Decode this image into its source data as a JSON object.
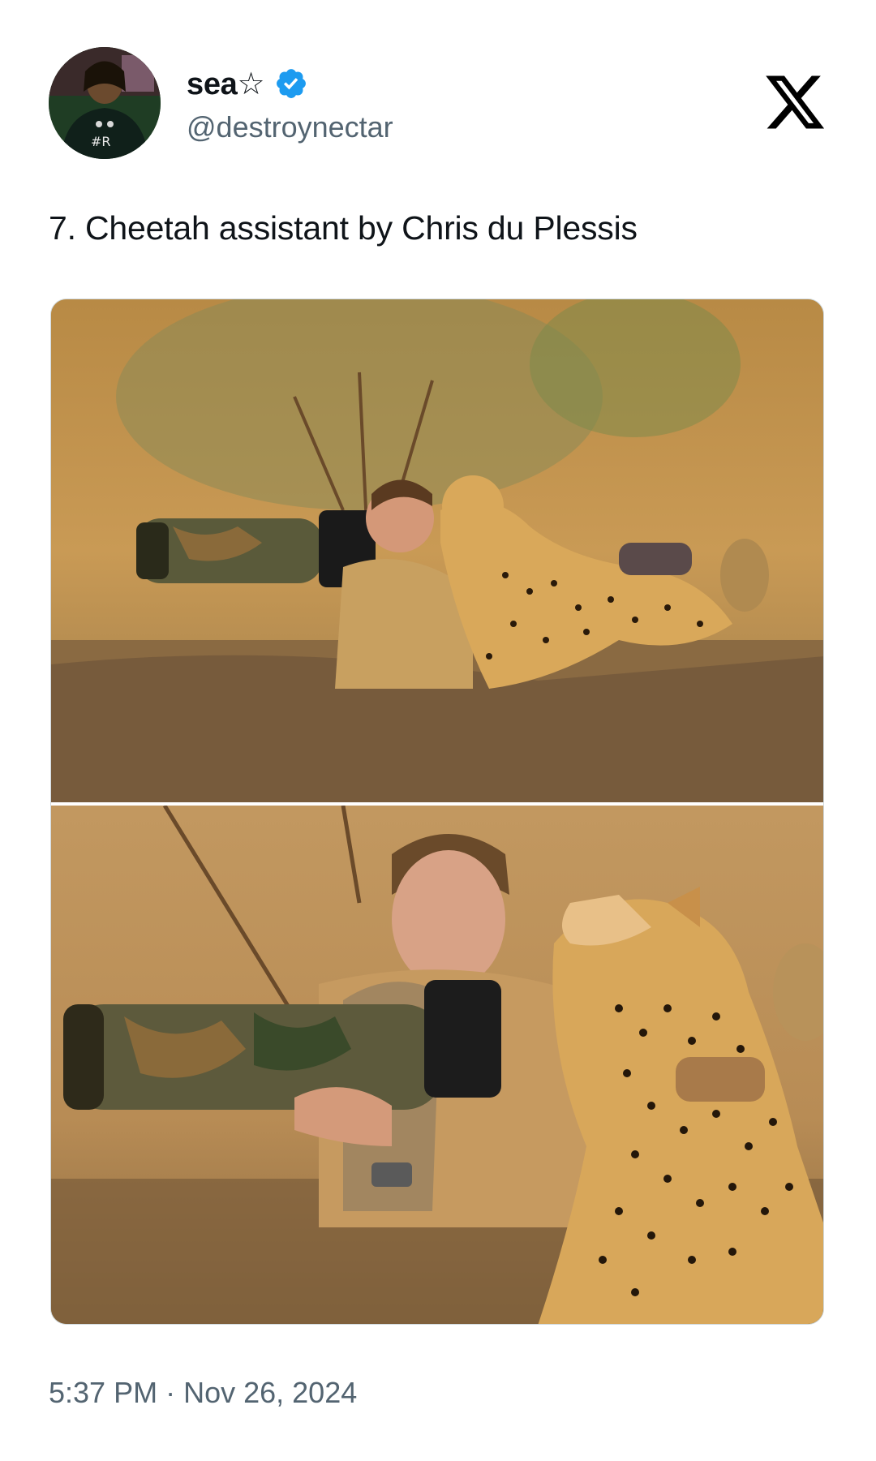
{
  "author": {
    "display_name": "sea☆",
    "handle": "@destroynectar",
    "verified": true,
    "avatar_icon": "profile-avatar"
  },
  "brand": {
    "logo": "x-logo"
  },
  "tweet": {
    "text": "7. Cheetah assistant by Chris du Plessis",
    "media": [
      {
        "description_icon": "photo-photographer-with-cheetah-wide"
      },
      {
        "description_icon": "photo-photographer-with-cheetah-closeup"
      }
    ]
  },
  "meta": {
    "time": "5:37 PM",
    "separator": "·",
    "date": "Nov 26, 2024"
  },
  "colors": {
    "verified_blue": "#1d9bf0",
    "text_primary": "#0f1419",
    "text_secondary": "#536471"
  }
}
